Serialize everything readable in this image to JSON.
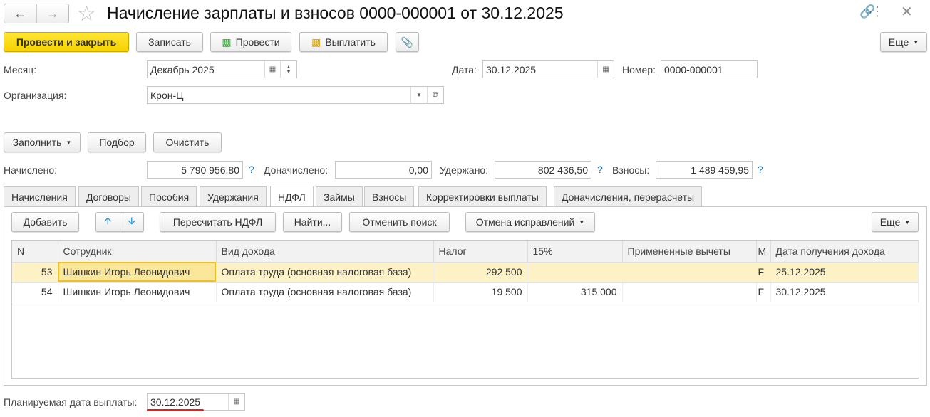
{
  "title": "Начисление зарплаты и взносов 0000-000001 от 30.12.2025",
  "toolbar": {
    "post_close": "Провести и закрыть",
    "save": "Записать",
    "post": "Провести",
    "pay": "Выплатить",
    "more": "Еще"
  },
  "header": {
    "month_label": "Месяц:",
    "month_value": "Декабрь 2025",
    "date_label": "Дата:",
    "date_value": "30.12.2025",
    "number_label": "Номер:",
    "number_value": "0000-000001",
    "org_label": "Организация:",
    "org_value": "Крон-Ц"
  },
  "actions": {
    "fill": "Заполнить",
    "select": "Подбор",
    "clear": "Очистить"
  },
  "totals": {
    "accrued_label": "Начислено:",
    "accrued": "5 790 956,80",
    "extra_label": "Доначислено:",
    "extra": "0,00",
    "withheld_label": "Удержано:",
    "withheld": "802 436,50",
    "contrib_label": "Взносы:",
    "contrib": "1 489 459,95",
    "help": "?"
  },
  "tabs": [
    "Начисления",
    "Договоры",
    "Пособия",
    "Удержания",
    "НДФЛ",
    "Займы",
    "Взносы",
    "Корректировки выплаты",
    "Доначисления, перерасчеты"
  ],
  "table_toolbar": {
    "add": "Добавить",
    "recalc": "Пересчитать НДФЛ",
    "find": "Найти...",
    "cancel_search": "Отменить поиск",
    "cancel_fix": "Отмена исправлений",
    "more": "Еще"
  },
  "table": {
    "columns": [
      "N",
      "Сотрудник",
      "Вид дохода",
      "Налог",
      "15%",
      "Примененные вычеты",
      "М",
      "Дата получения дохода"
    ],
    "rows": [
      [
        "53",
        "Шишкин Игорь Леонидович",
        "Оплата труда (основная налоговая база)",
        "292 500",
        "",
        "",
        "F",
        "25.12.2025"
      ],
      [
        "54",
        "Шишкин Игорь Леонидович",
        "Оплата труда (основная налоговая база)",
        "19 500",
        "315 000",
        "",
        "F",
        "30.12.2025"
      ]
    ]
  },
  "footer": {
    "pay_date_label": "Планируемая дата выплаты:",
    "pay_date": "30.12.2025"
  }
}
